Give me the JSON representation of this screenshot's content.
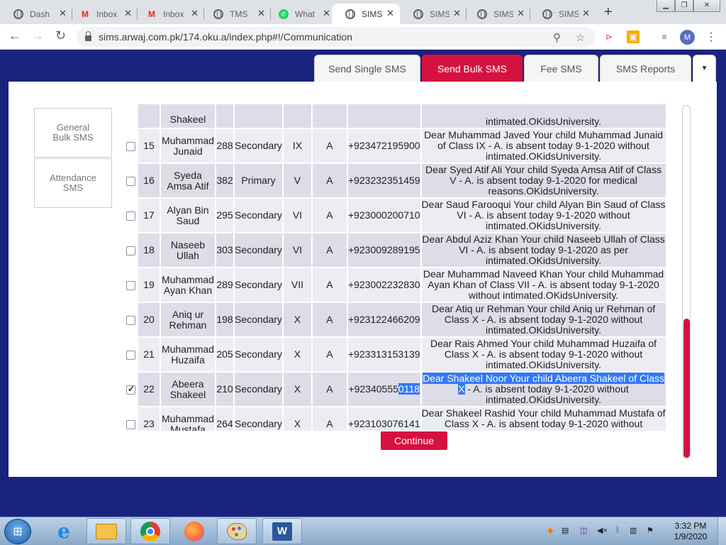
{
  "browser": {
    "tabs": [
      {
        "label": "Dash",
        "icon": "globe-icon",
        "active": false
      },
      {
        "label": "Inbox",
        "icon": "gmail-icon",
        "active": false
      },
      {
        "label": "Inbox",
        "icon": "gmail-icon",
        "active": false
      },
      {
        "label": "TMS",
        "icon": "globe-icon",
        "active": false
      },
      {
        "label": "What",
        "icon": "whatsapp-icon",
        "active": false
      },
      {
        "label": "SIMS",
        "icon": "globe-icon",
        "active": true
      },
      {
        "label": "SIMS",
        "icon": "globe-icon",
        "active": false
      },
      {
        "label": "SIMS",
        "icon": "globe-icon",
        "active": false
      },
      {
        "label": "SIMS",
        "icon": "globe-icon",
        "active": false
      }
    ],
    "url": "sims.arwaj.com.pk/174.oku.a/index.php#!/Communication",
    "profile_initial": "M"
  },
  "nav_tabs": [
    "Send Single SMS",
    "Send Bulk SMS",
    "Fee SMS",
    "SMS Reports"
  ],
  "side_menu": [
    "General Bulk SMS",
    "Attendance SMS"
  ],
  "partial_top_row": {
    "name": "Shakeel",
    "message": "intimated.OKidsUniversity."
  },
  "rows": [
    {
      "no": "15",
      "name": "Muhammad Junaid",
      "id": "288",
      "level": "Secondary",
      "class": "IX",
      "section": "A",
      "phone": "+923472195900",
      "message": "Dear Muhammad Javed Your child Muhammad Junaid of Class IX - A. is absent today 9-1-2020 without intimated.OKidsUniversity.",
      "checked": false
    },
    {
      "no": "16",
      "name": "Syeda Amsa Atif",
      "id": "382",
      "level": "Primary",
      "class": "V",
      "section": "A",
      "phone": "+923232351459",
      "message": "Dear Syed Atif Ali Your child Syeda Amsa Atif of Class V - A. is absent today 9-1-2020 for medical reasons.OKidsUniversity.",
      "checked": false
    },
    {
      "no": "17",
      "name": "Alyan Bin Saud",
      "id": "295",
      "level": "Secondary",
      "class": "VI",
      "section": "A",
      "phone": "+923000200710",
      "message": "Dear Saud Farooqui Your child Alyan Bin Saud of Class VI - A. is absent today 9-1-2020 without intimated.OKidsUniversity.",
      "checked": false
    },
    {
      "no": "18",
      "name": "Naseeb Ullah",
      "id": "303",
      "level": "Secondary",
      "class": "VI",
      "section": "A",
      "phone": "+923009289195",
      "message": "Dear Abdul Aziz Khan Your child Naseeb Ullah of Class VI - A. is absent today 9-1-2020 as per intimated.OKidsUniversity.",
      "checked": false
    },
    {
      "no": "19",
      "name": "Muhammad Ayan Khan",
      "id": "289",
      "level": "Secondary",
      "class": "VII",
      "section": "A",
      "phone": "+923002232830",
      "message": "Dear Muhammad Naveed Khan Your child Muhammad Ayan Khan of Class VII - A. is absent today 9-1-2020 without intimated.OKidsUniversity.",
      "checked": false
    },
    {
      "no": "20",
      "name": "Aniq ur Rehman",
      "id": "198",
      "level": "Secondary",
      "class": "X",
      "section": "A",
      "phone": "+923122466209",
      "message": "Dear Atiq ur Rehman Your child Aniq ur Rehman of Class X - A. is absent today 9-1-2020 without intimated.OKidsUniversity.",
      "checked": false
    },
    {
      "no": "21",
      "name": "Muhammad Huzaifa",
      "id": "205",
      "level": "Secondary",
      "class": "X",
      "section": "A",
      "phone": "+923313153139",
      "message": "Dear Rais Ahmed Your child Muhammad Huzaifa of Class X - A. is absent today 9-1-2020 without intimated.OKidsUniversity.",
      "checked": false
    },
    {
      "no": "22",
      "name": "Abeera Shakeel",
      "id": "210",
      "level": "Secondary",
      "class": "X",
      "section": "A",
      "phone_plain": "+92340555",
      "phone_selected": "0118",
      "message_selected": "Dear Shakeel Noor Your child Abeera Shakeel of Class X",
      "message_rest": " - A. is absent today 9-1-2020 without intimated.OKidsUniversity.",
      "checked": true
    },
    {
      "no": "23",
      "name": "Muhammad Mustafa",
      "id": "264",
      "level": "Secondary",
      "class": "X",
      "section": "A",
      "phone": "+923103076141",
      "message": "Dear Shakeel Rashid Your child Muhammad Mustafa of Class X - A. is absent today 9-1-2020 without intimated.OKidsUniversity.",
      "checked": false
    }
  ],
  "continue_label": "Continue",
  "accent_color": "#d5113f",
  "taskbar": {
    "time": "3:32 PM",
    "date": "1/9/2020",
    "apps": [
      "internet-explorer-icon",
      "file-explorer-icon",
      "chrome-icon",
      "firefox-icon",
      "paint-icon",
      "word-icon"
    ]
  }
}
